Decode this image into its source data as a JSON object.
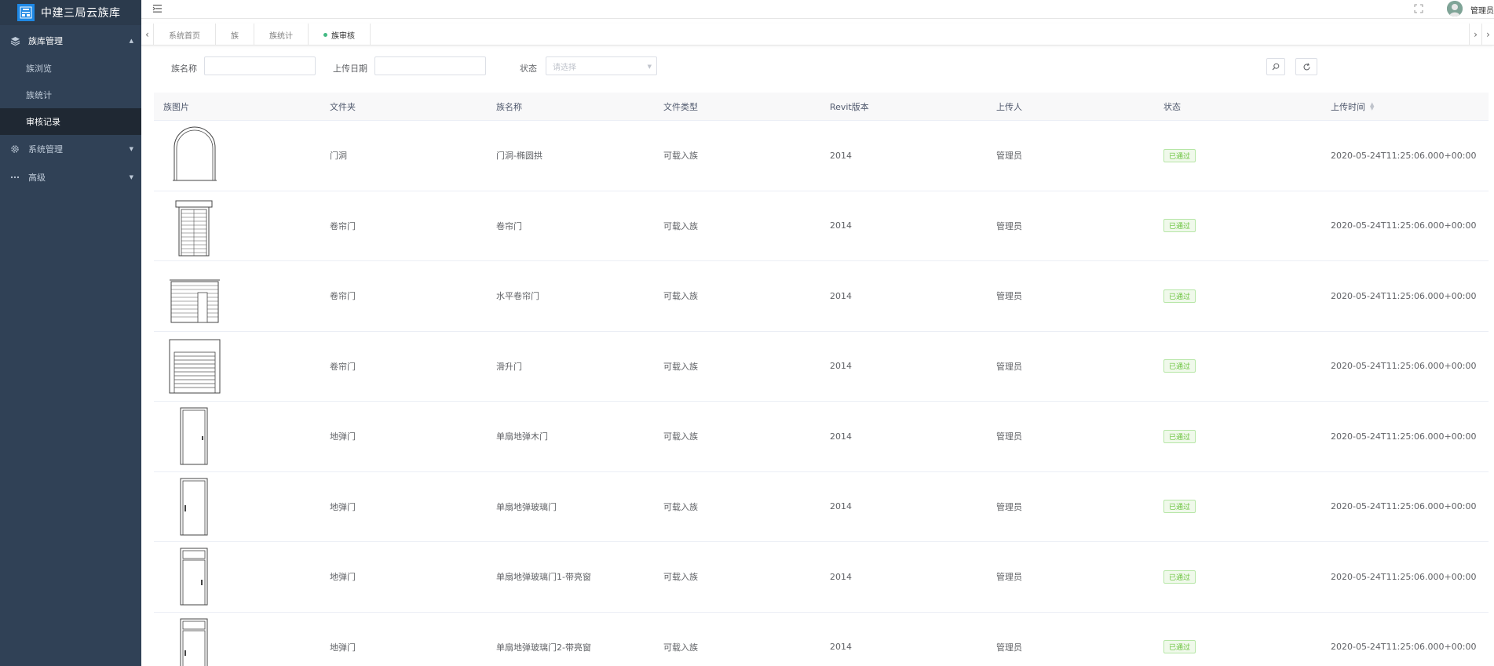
{
  "app": {
    "title": "中建三局云族库",
    "user_name": "管理员"
  },
  "sidebar": {
    "groups": [
      {
        "label": "族库管理",
        "icon": "cube-icon",
        "expanded": true,
        "items": [
          {
            "label": "族浏览",
            "active": false
          },
          {
            "label": "族统计",
            "active": false
          },
          {
            "label": "审核记录",
            "active": true
          }
        ]
      },
      {
        "label": "系统管理",
        "icon": "gear-icon",
        "expanded": false
      },
      {
        "label": "高级",
        "icon": "more-icon",
        "expanded": false
      }
    ]
  },
  "tabs": [
    {
      "label": "系统首页",
      "active": false
    },
    {
      "label": "族",
      "active": false
    },
    {
      "label": "族统计",
      "active": false
    },
    {
      "label": "族审核",
      "active": true
    }
  ],
  "filters": {
    "name_label": "族名称",
    "name_value": "",
    "date_label": "上传日期",
    "date_value": "",
    "status_label": "状态",
    "status_placeholder": "请选择"
  },
  "table": {
    "columns": [
      "族图片",
      "文件夹",
      "族名称",
      "文件类型",
      "Revit版本",
      "上传人",
      "状态",
      "上传时间"
    ],
    "rows": [
      {
        "thumb": "arch-door",
        "folder": "门洞",
        "name": "门洞-椭圆拱",
        "type": "可载入族",
        "revit": "2014",
        "uploader": "管理员",
        "status": "已通过",
        "time": "2020-05-24T11:25:06.000+00:00"
      },
      {
        "thumb": "roller-door",
        "folder": "卷帘门",
        "name": "卷帘门",
        "type": "可载入族",
        "revit": "2014",
        "uploader": "管理员",
        "status": "已通过",
        "time": "2020-05-24T11:25:06.000+00:00"
      },
      {
        "thumb": "horizontal-roller",
        "folder": "卷帘门",
        "name": "水平卷帘门",
        "type": "可载入族",
        "revit": "2014",
        "uploader": "管理员",
        "status": "已通过",
        "time": "2020-05-24T11:25:06.000+00:00"
      },
      {
        "thumb": "lift-door",
        "folder": "卷帘门",
        "name": "滑升门",
        "type": "可载入族",
        "revit": "2014",
        "uploader": "管理员",
        "status": "已通过",
        "time": "2020-05-24T11:25:06.000+00:00"
      },
      {
        "thumb": "single-door",
        "folder": "地弹门",
        "name": "单扇地弹木门",
        "type": "可载入族",
        "revit": "2014",
        "uploader": "管理员",
        "status": "已通过",
        "time": "2020-05-24T11:25:06.000+00:00"
      },
      {
        "thumb": "single-glass-door",
        "folder": "地弹门",
        "name": "单扇地弹玻璃门",
        "type": "可载入族",
        "revit": "2014",
        "uploader": "管理员",
        "status": "已通过",
        "time": "2020-05-24T11:25:06.000+00:00"
      },
      {
        "thumb": "transom-door-1",
        "folder": "地弹门",
        "name": "单扇地弹玻璃门1-带亮窗",
        "type": "可载入族",
        "revit": "2014",
        "uploader": "管理员",
        "status": "已通过",
        "time": "2020-05-24T11:25:06.000+00:00"
      },
      {
        "thumb": "transom-door-2",
        "folder": "地弹门",
        "name": "单扇地弹玻璃门2-带亮窗",
        "type": "可载入族",
        "revit": "2014",
        "uploader": "管理员",
        "status": "已通过",
        "time": "2020-05-24T11:25:06.000+00:00"
      }
    ]
  },
  "colors": {
    "sidebar_bg": "#304156",
    "accent_green": "#67c23a",
    "tab_dot": "#42b983"
  }
}
